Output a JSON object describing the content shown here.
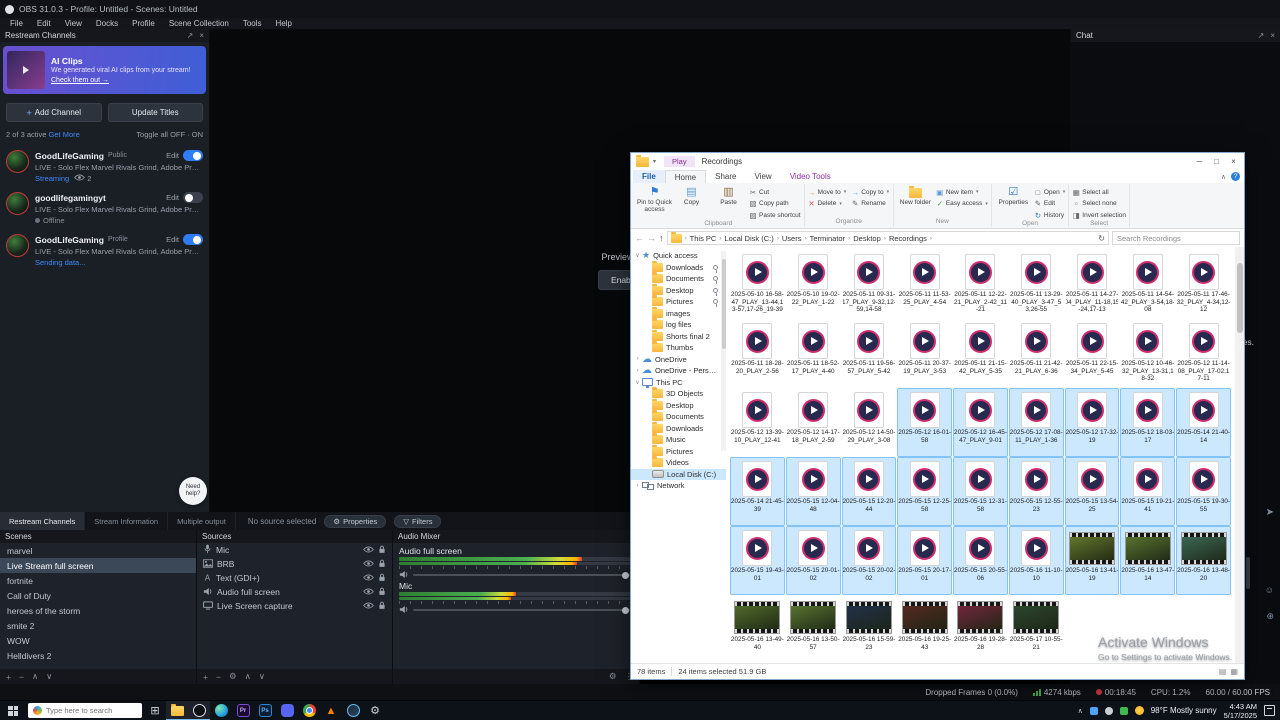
{
  "colors": {
    "accent": "#3d8bfd",
    "selection": "#cce8ff",
    "selection_border": "#84c3f5",
    "contextual_purple": "#8b2fa8",
    "toggle_on": "#2e7cf6",
    "meter_green": "#4caf50",
    "live_red": "#d93a3f"
  },
  "obs": {
    "title": "OBS 31.0.3 - Profile: Untitled - Scenes: Untitled",
    "menu": [
      "File",
      "Edit",
      "View",
      "Docks",
      "Profile",
      "Scene Collection",
      "Tools",
      "Help"
    ]
  },
  "restream": {
    "header": "Restream Channels",
    "banner": {
      "title": "AI Clips",
      "desc": "We generated viral AI clips from your stream!",
      "link": "Check them out →"
    },
    "add_channel": "Add Channel",
    "update_titles": "Update Titles",
    "active_summary": "2 of 3 active",
    "get_more": "Get More",
    "toggle_all": "Toggle all",
    "toggle_off": "OFF",
    "toggle_on": "ON",
    "channels": [
      {
        "name": "GoodLifeGaming",
        "badge": "Public",
        "edit": "Edit",
        "title": "LIVE - Solo Flex Marvel Rivals Grind, Adobe Premie...",
        "status": "Streaming",
        "status_type": "live",
        "viewers": "2",
        "enabled": true
      },
      {
        "name": "goodlifegamingyt",
        "badge": "",
        "edit": "Edit",
        "title": "LIVE - Solo Flex Marvel Rivals Grind, Adobe Premie...",
        "status": "Offline",
        "status_type": "offline",
        "viewers": "",
        "enabled": false
      },
      {
        "name": "GoodLifeGaming",
        "badge": "Profile",
        "edit": "Edit",
        "title": "LIVE - Solo Flex Marvel Rivals Grind, Adobe Premie...",
        "status": "Sending data...",
        "status_type": "live",
        "viewers": "",
        "enabled": true
      }
    ]
  },
  "preview": {
    "disabled_text": "Preview is disabled",
    "enable_button": "Enable preview",
    "help_bubble": "Need help?"
  },
  "dock_tabs": [
    {
      "label": "Restream Channels",
      "active": true
    },
    {
      "label": "Stream Information",
      "active": false
    },
    {
      "label": "Multiple output",
      "active": false
    }
  ],
  "source_toolbar": {
    "no_source": "No source selected",
    "properties": "Properties",
    "filters": "Filters"
  },
  "scenes": {
    "header": "Scenes",
    "items": [
      {
        "label": "marvel",
        "selected": false
      },
      {
        "label": "Live Stream full screen",
        "selected": true
      },
      {
        "label": "fortnite",
        "selected": false
      },
      {
        "label": "Call of Duty",
        "selected": false
      },
      {
        "label": "heroes of the storm",
        "selected": false
      },
      {
        "label": "smite 2",
        "selected": false
      },
      {
        "label": "WOW",
        "selected": false
      },
      {
        "label": "Helldivers 2",
        "selected": false
      }
    ]
  },
  "sources": {
    "header": "Sources",
    "items": [
      {
        "label": "Mic",
        "icon": "mic-icon"
      },
      {
        "label": "BRB",
        "icon": "image-icon"
      },
      {
        "label": "Text (GDI+)",
        "icon": "text-icon"
      },
      {
        "label": "Audio full screen",
        "icon": "speaker-icon"
      },
      {
        "label": "Live Screen capture",
        "icon": "display-icon"
      }
    ]
  },
  "mixer": {
    "header": "Audio Mixer",
    "tracks": [
      {
        "label": "Audio full screen",
        "level": 0.78
      },
      {
        "label": "Mic",
        "level": 0.5
      }
    ]
  },
  "status_bar": {
    "dropped": "Dropped Frames 0 (0.0%)",
    "bitrate": "4274 kbps",
    "stream_time": "00:18:45",
    "cpu": "CPU: 1.2%",
    "fps": "60.00 / 60.00 FPS"
  },
  "chat": {
    "header": "Chat",
    "message_tail": "ges."
  },
  "watermark": {
    "line1": "Activate Windows",
    "line2": "Go to Settings to activate Windows."
  },
  "explorer": {
    "title_tab": "Play",
    "title": "Recordings",
    "ribbon_tabs": [
      {
        "label": "File",
        "style": "file"
      },
      {
        "label": "Home",
        "style": "active"
      },
      {
        "label": "Share",
        "style": ""
      },
      {
        "label": "View",
        "style": ""
      },
      {
        "label": "Video Tools",
        "style": "contextual"
      }
    ],
    "groups": [
      {
        "name": "Clipboard",
        "big": [
          {
            "label": "Pin to Quick access",
            "icon": "pin-icon"
          },
          {
            "label": "Copy",
            "icon": "copy-icon"
          },
          {
            "label": "Paste",
            "icon": "paste-icon"
          }
        ],
        "small": [
          {
            "label": "Cut",
            "icon": "cut-icon"
          },
          {
            "label": "Copy path",
            "icon": "copy-path-icon"
          },
          {
            "label": "Paste shortcut",
            "icon": "paste-shortcut-icon"
          }
        ]
      },
      {
        "name": "Organize",
        "cols2": true,
        "big": [],
        "small": [
          {
            "label": "Move to",
            "icon": "move-icon",
            "menu": true
          },
          {
            "label": "Copy to",
            "icon": "copy-to-icon",
            "menu": true
          },
          {
            "label": "Delete",
            "icon": "delete-icon",
            "menu": true
          },
          {
            "label": "Rename",
            "icon": "rename-icon"
          }
        ]
      },
      {
        "name": "New",
        "big": [
          {
            "label": "New folder",
            "icon": "new-folder-icon"
          }
        ],
        "small": [
          {
            "label": "New item",
            "icon": "new-item-icon",
            "menu": true
          },
          {
            "label": "Easy access",
            "icon": "easy-access-icon",
            "menu": true
          }
        ]
      },
      {
        "name": "Open",
        "big": [
          {
            "label": "Properties",
            "icon": "properties-icon"
          }
        ],
        "small": [
          {
            "label": "Open",
            "icon": "open-icon",
            "menu": true
          },
          {
            "label": "Edit",
            "icon": "edit-icon"
          },
          {
            "label": "History",
            "icon": "history-icon"
          }
        ]
      },
      {
        "name": "Select",
        "big": [],
        "small": [
          {
            "label": "Select all",
            "icon": "select-all-icon"
          },
          {
            "label": "Select none",
            "icon": "select-none-icon"
          },
          {
            "label": "Invert selection",
            "icon": "invert-selection-icon"
          }
        ]
      }
    ],
    "breadcrumb": [
      "This PC",
      "Local Disk (C:)",
      "Users",
      "Terminator",
      "Desktop",
      "Recordings"
    ],
    "search_placeholder": "Search Recordings",
    "nav": [
      {
        "label": "Quick access",
        "icon": "star-icon",
        "depth": 0,
        "expander": "v",
        "pinned": false,
        "selected": false
      },
      {
        "label": "Downloads",
        "icon": "folder-icon",
        "depth": 1,
        "expander": "",
        "pinned": true,
        "selected": false
      },
      {
        "label": "Documents",
        "icon": "folder-icon",
        "depth": 1,
        "expander": "",
        "pinned": true,
        "selected": false
      },
      {
        "label": "Desktop",
        "icon": "folder-icon",
        "depth": 1,
        "expander": "",
        "pinned": true,
        "selected": false
      },
      {
        "label": "Pictures",
        "icon": "folder-icon",
        "depth": 1,
        "expander": "",
        "pinned": true,
        "selected": false
      },
      {
        "label": "images",
        "icon": "folder-icon",
        "depth": 1,
        "expander": "",
        "pinned": false,
        "selected": false
      },
      {
        "label": "log files",
        "icon": "folder-icon",
        "depth": 1,
        "expander": "",
        "pinned": false,
        "selected": false
      },
      {
        "label": "Shorts final 2",
        "icon": "folder-icon",
        "depth": 1,
        "expander": "",
        "pinned": false,
        "selected": false
      },
      {
        "label": "Thumbs",
        "icon": "folder-icon",
        "depth": 1,
        "expander": "",
        "pinned": false,
        "selected": false
      },
      {
        "label": "OneDrive",
        "icon": "cloud-icon",
        "depth": 0,
        "expander": ">",
        "pinned": false,
        "selected": false
      },
      {
        "label": "OneDrive - Personal",
        "icon": "cloud-icon",
        "depth": 0,
        "expander": ">",
        "pinned": false,
        "selected": false
      },
      {
        "label": "This PC",
        "icon": "pc-icon",
        "depth": 0,
        "expander": "v",
        "pinned": false,
        "selected": false
      },
      {
        "label": "3D Objects",
        "icon": "folder-icon",
        "depth": 1,
        "expander": "",
        "pinned": false,
        "selected": false
      },
      {
        "label": "Desktop",
        "icon": "folder-icon",
        "depth": 1,
        "expander": "",
        "pinned": false,
        "selected": false
      },
      {
        "label": "Documents",
        "icon": "folder-icon",
        "depth": 1,
        "expander": "",
        "pinned": false,
        "selected": false
      },
      {
        "label": "Downloads",
        "icon": "folder-icon",
        "depth": 1,
        "expander": "",
        "pinned": false,
        "selected": false
      },
      {
        "label": "Music",
        "icon": "folder-icon",
        "depth": 1,
        "expander": "",
        "pinned": false,
        "selected": false
      },
      {
        "label": "Pictures",
        "icon": "folder-icon",
        "depth": 1,
        "expander": "",
        "pinned": false,
        "selected": false
      },
      {
        "label": "Videos",
        "icon": "folder-icon",
        "depth": 1,
        "expander": "",
        "pinned": false,
        "selected": false
      },
      {
        "label": "Local Disk (C:)",
        "icon": "disk-icon",
        "depth": 1,
        "expander": "",
        "pinned": false,
        "selected": true
      },
      {
        "label": "Network",
        "icon": "network-icon",
        "depth": 0,
        "expander": ">",
        "pinned": false,
        "selected": false
      }
    ],
    "files": [
      {
        "name": "2025-05-10 16-58-47_PLAY_13-44,13-57,17-26_19-39",
        "selected": false
      },
      {
        "name": "2025-05-10 19-02-22_PLAY_1-22",
        "selected": false
      },
      {
        "name": "2025-05-11 09-31-17_PLAY_9-32,12-59,14-58",
        "selected": false
      },
      {
        "name": "2025-05-11 11-53-25_PLAY_4-54",
        "selected": false
      },
      {
        "name": "2025-05-11 12-22-21_PLAY_2-42_11-21",
        "selected": false
      },
      {
        "name": "2025-05-11 13-29-40_PLAY_3-47_53,26-55",
        "selected": false
      },
      {
        "name": "2025-05-11 14-27-04_PLAY_11-18,15-24,17-13",
        "selected": false
      },
      {
        "name": "2025-05-11 14-54-42_PLAY_3-54,18-08",
        "selected": false
      },
      {
        "name": "2025-05-11 17-46-32_PLAY_4-34,12-12",
        "selected": false
      },
      {
        "name": "2025-05-11 18-28-20_PLAY_2-56",
        "selected": false
      },
      {
        "name": "2025-05-11 18-52-17_PLAY_4-40",
        "selected": false
      },
      {
        "name": "2025-05-11 19-56-57_PLAY_5-42",
        "selected": false
      },
      {
        "name": "2025-05-11 20-37-19_PLAY_3-53",
        "selected": false
      },
      {
        "name": "2025-05-11 21-15-42_PLAY_5-35",
        "selected": false
      },
      {
        "name": "2025-05-11 21-42-21_PLAY_6-36",
        "selected": false
      },
      {
        "name": "2025-05-11 22-15-34_PLAY_5-45",
        "selected": false
      },
      {
        "name": "2025-05-12 10-46-32_PLAY_13-31,18-32",
        "selected": false
      },
      {
        "name": "2025-05-12 11-14-08_PLAY_17-02,17-11",
        "selected": false
      },
      {
        "name": "2025-05-12 13-39-10_PLAY_12-41",
        "selected": false
      },
      {
        "name": "2025-05-12 14-17-18_PLAY_2-59",
        "selected": false
      },
      {
        "name": "2025-05-12 14-50-29_PLAY_3-08",
        "selected": false
      },
      {
        "name": "2025-05-12 16-01-58",
        "selected": true
      },
      {
        "name": "2025-05-12 16-45-47_PLAY_9-01",
        "selected": true
      },
      {
        "name": "2025-05-12 17-08-11_PLAY_1-36",
        "selected": true
      },
      {
        "name": "2025-05-12 17-32-19",
        "selected": true
      },
      {
        "name": "2025-05-12 18-03-17",
        "selected": true
      },
      {
        "name": "2025-05-14 21-40-14",
        "selected": true
      },
      {
        "name": "2025-05-14 21-45-39",
        "selected": true
      },
      {
        "name": "2025-05-15 12-04-48",
        "selected": true
      },
      {
        "name": "2025-05-15 12-20-44",
        "selected": true
      },
      {
        "name": "2025-05-15 12-25-58",
        "selected": true
      },
      {
        "name": "2025-05-15 12-31-58",
        "selected": true
      },
      {
        "name": "2025-05-15 12-55-23",
        "selected": true
      },
      {
        "name": "2025-05-15 13-54-25",
        "selected": true
      },
      {
        "name": "2025-05-15 19-21-41",
        "selected": true
      },
      {
        "name": "2025-05-15 19-30-55",
        "selected": true
      },
      {
        "name": "2025-05-15 19-43-01",
        "selected": true
      },
      {
        "name": "2025-05-15 20-01-02",
        "selected": true
      },
      {
        "name": "2025-05-15 20-02-02",
        "selected": true
      },
      {
        "name": "2025-05-15 20-17-01",
        "selected": true
      },
      {
        "name": "2025-05-15 20-55-06",
        "selected": true
      },
      {
        "name": "2025-05-16 11-10-10",
        "selected": true
      },
      {
        "name": "2025-05-16 13-41-19",
        "selected": true,
        "thumb": "#6a7f2f"
      },
      {
        "name": "2025-05-16 13-47-14",
        "selected": true,
        "thumb": "#5d7a33"
      },
      {
        "name": "2025-05-16 13-48-20",
        "selected": true,
        "thumb": "#3f6d5a"
      },
      {
        "name": "2025-05-16 13-49-40",
        "selected": false,
        "thumb": "#55702c"
      },
      {
        "name": "2025-05-16 13-50-57",
        "selected": false,
        "thumb": "#5d7a33"
      },
      {
        "name": "2025-05-16 15-59-23",
        "selected": false,
        "thumb": "#23324f"
      },
      {
        "name": "2025-05-16 19-25-43",
        "selected": false,
        "thumb": "#5a2a22"
      },
      {
        "name": "2025-05-16 19-28-28",
        "selected": false,
        "thumb": "#7a2740"
      },
      {
        "name": "2025-05-17 10-55-21",
        "selected": false,
        "thumb": "#2e4a33"
      }
    ],
    "status_items": "78 items",
    "status_selected": "24 items selected 51.9 GB"
  },
  "taskbar": {
    "search_placeholder": "Type here to search",
    "icons": [
      {
        "name": "task-view",
        "active": false
      },
      {
        "name": "file-explorer",
        "active": true
      },
      {
        "name": "obs-studio",
        "active": true
      },
      {
        "name": "edge",
        "active": false
      },
      {
        "name": "premiere-pro",
        "active": false
      },
      {
        "name": "photoshop",
        "active": false
      },
      {
        "name": "discord",
        "active": false
      },
      {
        "name": "chrome",
        "active": false
      },
      {
        "name": "vlc",
        "active": false
      },
      {
        "name": "steam",
        "active": false
      },
      {
        "name": "settings",
        "active": false
      }
    ],
    "weather": "98°F Mostly sunny",
    "time": "4:43 AM",
    "date": "5/17/2025"
  }
}
